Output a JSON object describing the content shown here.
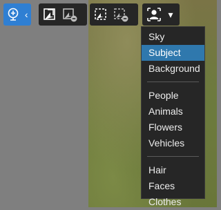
{
  "toolbar": {
    "collapse_chevron": "‹",
    "dropdown_caret": "▾"
  },
  "menu": {
    "groups": [
      [
        "Sky",
        "Subject",
        "Background"
      ],
      [
        "People",
        "Animals",
        "Flowers",
        "Vehicles"
      ],
      [
        "Hair",
        "Faces",
        "Clothes"
      ]
    ],
    "selected": "Subject"
  },
  "colors": {
    "accent": "#2f7fd3",
    "selected_item": "#2f78ad",
    "panel": "#262626",
    "canvas": "#7f7f7f"
  }
}
